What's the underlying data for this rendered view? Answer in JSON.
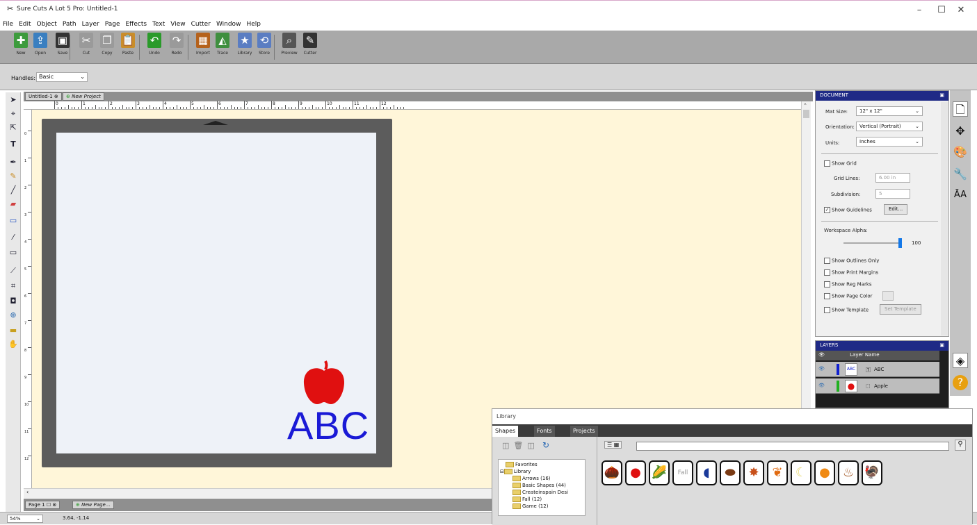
{
  "window": {
    "title": "Sure Cuts A Lot 5 Pro: Untitled-1",
    "minimize": "–",
    "maximize": "☐",
    "close": "✕"
  },
  "menu": [
    "File",
    "Edit",
    "Object",
    "Path",
    "Layer",
    "Page",
    "Effects",
    "Text",
    "View",
    "Cutter",
    "Window",
    "Help"
  ],
  "toolbar": [
    {
      "label": "New",
      "icon": "new-icon",
      "color": "#3d9b3d"
    },
    {
      "label": "Open",
      "icon": "open-icon",
      "color": "#3a7fc0"
    },
    {
      "label": "Save",
      "icon": "save-icon",
      "color": "#333"
    },
    {
      "label": "Cut",
      "icon": "cut-icon",
      "color": "#9a9a9a"
    },
    {
      "label": "Copy",
      "icon": "copy-icon",
      "color": "#9a9a9a"
    },
    {
      "label": "Paste",
      "icon": "paste-icon",
      "color": "#c98d2a"
    },
    {
      "label": "Undo",
      "icon": "undo-icon",
      "color": "#2a9a2a"
    },
    {
      "label": "Redo",
      "icon": "redo-icon",
      "color": "#9a9a9a"
    },
    {
      "label": "Import",
      "icon": "import-icon",
      "color": "#b5621c"
    },
    {
      "label": "Trace",
      "icon": "trace-icon",
      "color": "#3f8f3f"
    },
    {
      "label": "Library",
      "icon": "library-icon",
      "color": "#5a7dc2"
    },
    {
      "label": "Store",
      "icon": "store-icon",
      "color": "#5a7dc2"
    },
    {
      "label": "Preview",
      "icon": "preview-icon",
      "color": "#555"
    },
    {
      "label": "Cutter",
      "icon": "cutter-icon",
      "color": "#333"
    }
  ],
  "options": {
    "handles_label": "Handles:",
    "handles_value": "Basic"
  },
  "doc_tabs": {
    "active": "Untitled-1",
    "new": "New Project"
  },
  "ruler_ticks": [
    "0",
    "1",
    "2",
    "3",
    "4",
    "5",
    "6",
    "7",
    "8",
    "9",
    "10",
    "11",
    "12"
  ],
  "vruler_ticks": [
    "0",
    "1",
    "2",
    "3",
    "4",
    "5",
    "6",
    "7",
    "8",
    "9",
    "10",
    "11",
    "12"
  ],
  "canvas": {
    "text": "ABC",
    "text_color": "#1a1ad6",
    "apple_color": "#e01010"
  },
  "page_tabs": {
    "page": "Page 1",
    "new": "New Page..."
  },
  "status": {
    "zoom": "54%",
    "coords": "3.64, -1.14"
  },
  "document_panel": {
    "header": "DOCUMENT",
    "mat_size_label": "Mat Size:",
    "mat_size": "12\" x 12\"",
    "orientation_label": "Orientation:",
    "orientation": "Vertical (Portrait)",
    "units_label": "Units:",
    "units": "Inches",
    "show_grid": "Show Grid",
    "grid_lines_label": "Grid Lines:",
    "grid_lines": "6.00 in",
    "subdivision_label": "Subdivision:",
    "subdivision": "5",
    "show_guidelines": "Show Guidelines",
    "edit": "Edit...",
    "workspace_alpha_label": "Workspace Alpha:",
    "workspace_alpha": "100",
    "workspace_alpha_value": 1.0,
    "show_outlines": "Show Outlines Only",
    "show_print_margins": "Show Print Margins",
    "show_reg_marks": "Show Reg Marks",
    "show_page_color": "Show Page Color",
    "show_template": "Show Template",
    "set_template": "Set Template"
  },
  "layers_panel": {
    "header": "LAYERS",
    "col_name": "Layer Name",
    "layers": [
      {
        "name": "ABC",
        "color": "#1020d0",
        "thumb": "ABC"
      },
      {
        "name": "Apple",
        "color": "#20b020",
        "thumb": "●"
      }
    ]
  },
  "library": {
    "title": "Library",
    "tabs": [
      "Shapes",
      "Fonts",
      "Projects"
    ],
    "tree": [
      "Favorites",
      "Library",
      "Arrows (16)",
      "Basic Shapes (44)",
      "Createinspain Desi",
      "Fall (12)",
      "Game (12)"
    ],
    "shapes": [
      {
        "name": "acorn",
        "glyph": "🌰",
        "color": "#8a6a2a"
      },
      {
        "name": "apple",
        "glyph": "●",
        "color": "#e01010"
      },
      {
        "name": "corn",
        "glyph": "🌽",
        "color": "#c9b020"
      },
      {
        "name": "fall-text",
        "glyph": "Fall",
        "color": "#999"
      },
      {
        "name": "helmet",
        "glyph": "◖",
        "color": "#1a3a9a"
      },
      {
        "name": "football",
        "glyph": "⬬",
        "color": "#7a3a14"
      },
      {
        "name": "maple-leaf",
        "glyph": "✸",
        "color": "#c8501a"
      },
      {
        "name": "leaf",
        "glyph": "❦",
        "color": "#e06a10"
      },
      {
        "name": "moon",
        "glyph": "☾",
        "color": "#e8d870"
      },
      {
        "name": "pumpkin",
        "glyph": "●",
        "color": "#f08a14"
      },
      {
        "name": "turkey-dish",
        "glyph": "♨",
        "color": "#a0521e"
      },
      {
        "name": "turkey",
        "glyph": "🦃",
        "color": "#7a4a2a"
      }
    ]
  }
}
